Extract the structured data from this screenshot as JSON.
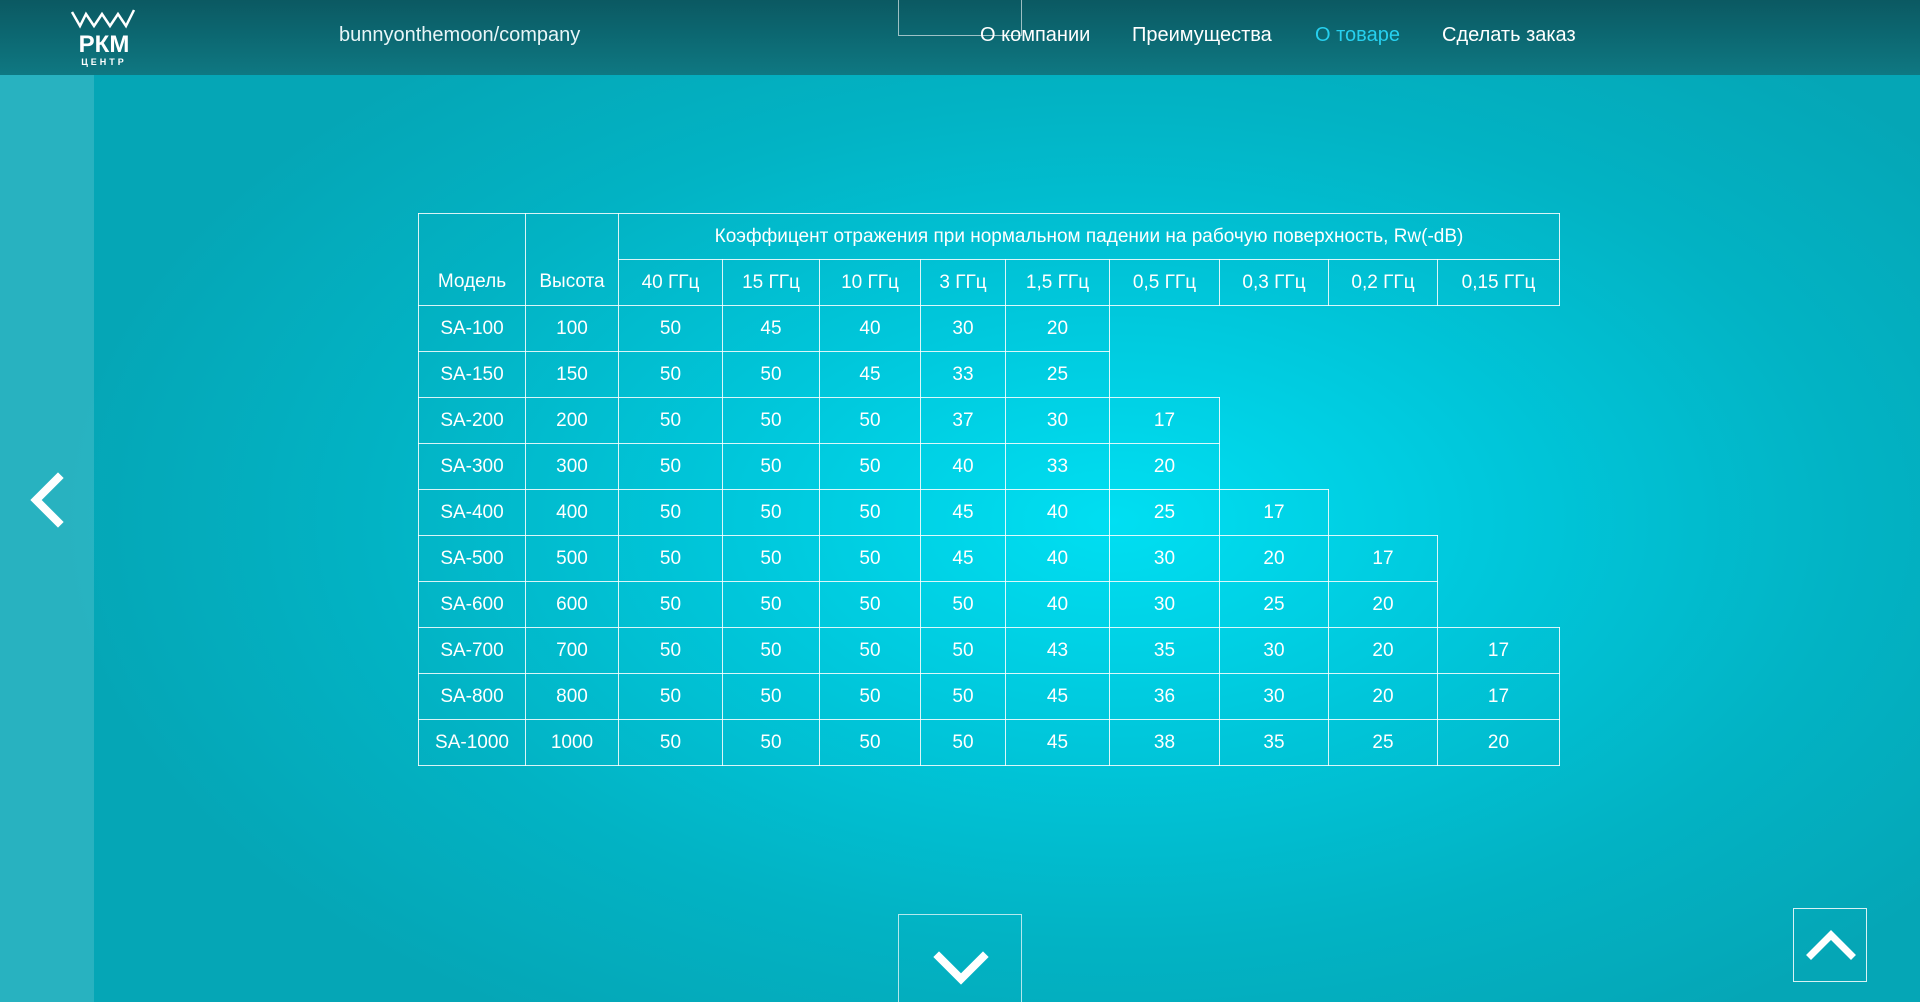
{
  "site": {
    "logo_text": "РКМ",
    "logo_subtext": "ЦЕНТР",
    "path": "bunnyonthemoon/company"
  },
  "nav": {
    "items": [
      {
        "label": "О компании"
      },
      {
        "label": "Преимущества"
      },
      {
        "label": "О товаре",
        "active": true
      },
      {
        "label": "Сделать заказ"
      }
    ]
  },
  "colors": {
    "accent": "#26d0ef",
    "header": "#0e7882",
    "background": "#00c8dc"
  },
  "icons": {
    "prev": "chevron-left-icon",
    "down": "chevron-down-icon",
    "up": "chevron-up-icon"
  },
  "table": {
    "col_model": "Модель",
    "col_height": "Высота",
    "group_header": "Коэффицент отражения при нормальном падении на рабочую поверхность, Rw(-dB)",
    "freq_headers": [
      "40 ГГц",
      "15 ГГц",
      "10 ГГц",
      "3 ГГц",
      "1,5 ГГц",
      "0,5 ГГц",
      "0,3 ГГц",
      "0,2 ГГц",
      "0,15 ГГц"
    ],
    "rows": [
      {
        "model": "SA-100",
        "height": "100",
        "values": [
          "50",
          "45",
          "40",
          "30",
          "20"
        ]
      },
      {
        "model": "SA-150",
        "height": "150",
        "values": [
          "50",
          "50",
          "45",
          "33",
          "25"
        ]
      },
      {
        "model": "SA-200",
        "height": "200",
        "values": [
          "50",
          "50",
          "50",
          "37",
          "30",
          "17"
        ]
      },
      {
        "model": "SA-300",
        "height": "300",
        "values": [
          "50",
          "50",
          "50",
          "40",
          "33",
          "20"
        ]
      },
      {
        "model": "SA-400",
        "height": "400",
        "values": [
          "50",
          "50",
          "50",
          "45",
          "40",
          "25",
          "17"
        ]
      },
      {
        "model": "SA-500",
        "height": "500",
        "values": [
          "50",
          "50",
          "50",
          "45",
          "40",
          "30",
          "20",
          "17"
        ]
      },
      {
        "model": "SA-600",
        "height": "600",
        "values": [
          "50",
          "50",
          "50",
          "50",
          "40",
          "30",
          "25",
          "20"
        ]
      },
      {
        "model": "SA-700",
        "height": "700",
        "values": [
          "50",
          "50",
          "50",
          "50",
          "43",
          "35",
          "30",
          "20",
          "17"
        ]
      },
      {
        "model": "SA-800",
        "height": "800",
        "values": [
          "50",
          "50",
          "50",
          "50",
          "45",
          "36",
          "30",
          "20",
          "17"
        ]
      },
      {
        "model": "SA-1000",
        "height": "1000",
        "values": [
          "50",
          "50",
          "50",
          "50",
          "45",
          "38",
          "35",
          "25",
          "20"
        ]
      }
    ]
  }
}
